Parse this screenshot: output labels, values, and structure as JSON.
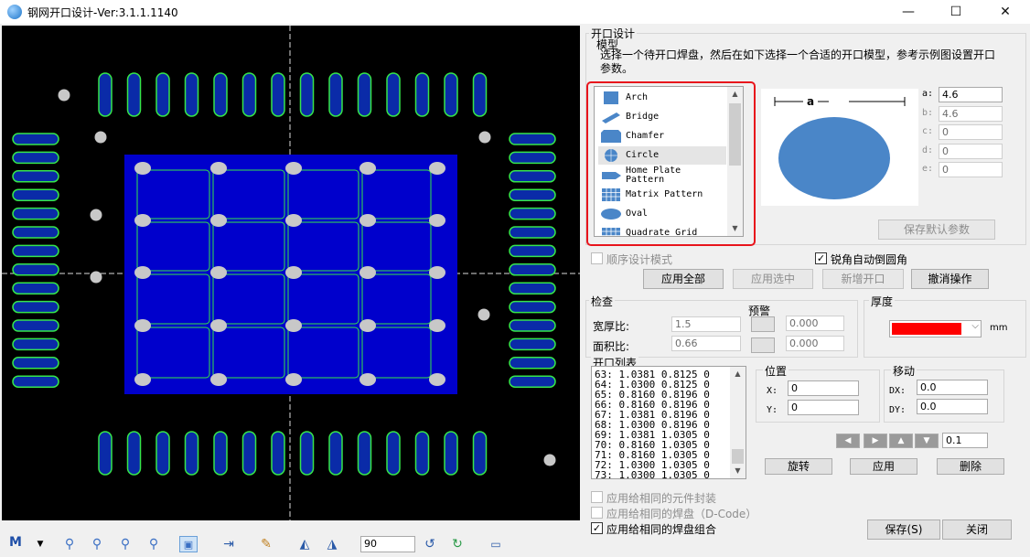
{
  "window": {
    "title": "钢网开口设计-Ver:3.1.1.1140",
    "minimize": "—",
    "maximize": "☐",
    "close": "✕"
  },
  "design": {
    "group_label": "开口设计",
    "model_label": "模型",
    "description": "选择一个待开口焊盘，然后在如下选择一个合适的开口模型，参考示例图设置开口参数。",
    "models": [
      {
        "label": "Arch",
        "icon": "arch-icon"
      },
      {
        "label": "Bridge",
        "icon": "bridge-icon"
      },
      {
        "label": "Chamfer",
        "icon": "chamfer-icon"
      },
      {
        "label": "Circle",
        "icon": "circle-icon"
      },
      {
        "label": "Home Plate\nPattern",
        "icon": "home-plate-icon"
      },
      {
        "label": "Matrix Pattern",
        "icon": "matrix-icon"
      },
      {
        "label": "Oval",
        "icon": "oval-icon"
      },
      {
        "label": "Quadrate Grid",
        "icon": "grid-icon"
      }
    ],
    "preview_dim": "a",
    "params": [
      {
        "name": "a:",
        "value": "4.6"
      },
      {
        "name": "b:",
        "value": "4.6"
      },
      {
        "name": "c:",
        "value": "0"
      },
      {
        "name": "d:",
        "value": "0"
      },
      {
        "name": "e:",
        "value": "0"
      }
    ],
    "save_default": "保存默认参数",
    "sequential_mode": "顺序设计模式",
    "auto_round": "锐角自动倒圆角",
    "apply_all": "应用全部",
    "apply_selected": "应用选中",
    "add_opening": "新增开口",
    "undo": "撤消操作"
  },
  "check": {
    "label": "检查",
    "warning_label": "预警",
    "ratio_label": "宽厚比:",
    "ratio_value": "1.5",
    "ratio_warn": "0.000",
    "area_label": "面积比:",
    "area_value": "0.66",
    "area_warn": "0.000"
  },
  "thickness": {
    "label": "厚度",
    "unit": "mm",
    "color": "#ff0000"
  },
  "opening_list": {
    "label": "开口列表",
    "rows": [
      "63: 1.0381 0.8125 0",
      "64: 1.0300 0.8125 0",
      "65: 0.8160 0.8196 0",
      "66: 0.8160 0.8196 0",
      "67: 1.0381 0.8196 0",
      "68: 1.0300 0.8196 0",
      "69: 1.0381 1.0305 0",
      "70: 0.8160 1.0305 0",
      "71: 0.8160 1.0305 0",
      "72: 1.0300 1.0305 0",
      "73: 1.0300 1.0305 0"
    ]
  },
  "position": {
    "label": "位置",
    "x_label": "X:",
    "x_value": "0",
    "y_label": "Y:",
    "y_value": "0"
  },
  "move": {
    "label": "移动",
    "dx_label": "DX:",
    "dx_value": "0.0",
    "dy_label": "DY:",
    "dy_value": "0.0",
    "step": "0.1"
  },
  "actions": {
    "rotate": "旋转",
    "apply": "应用",
    "delete": "删除"
  },
  "apply_options": {
    "same_package": "应用给相同的元件封装",
    "same_dcode": "应用给相同的焊盘（D-Code）",
    "same_group": "应用给相同的焊盘组合"
  },
  "footer": {
    "save": "保存(S)",
    "close": "关闭"
  },
  "toolbar": {
    "m_label": "M",
    "zoom_value": "90"
  },
  "colors": {
    "pad_fill": "#0a2ba8",
    "pad_outline": "#36e64a",
    "thermal_fill": "#0000cc",
    "via": "#c8c8c8"
  }
}
